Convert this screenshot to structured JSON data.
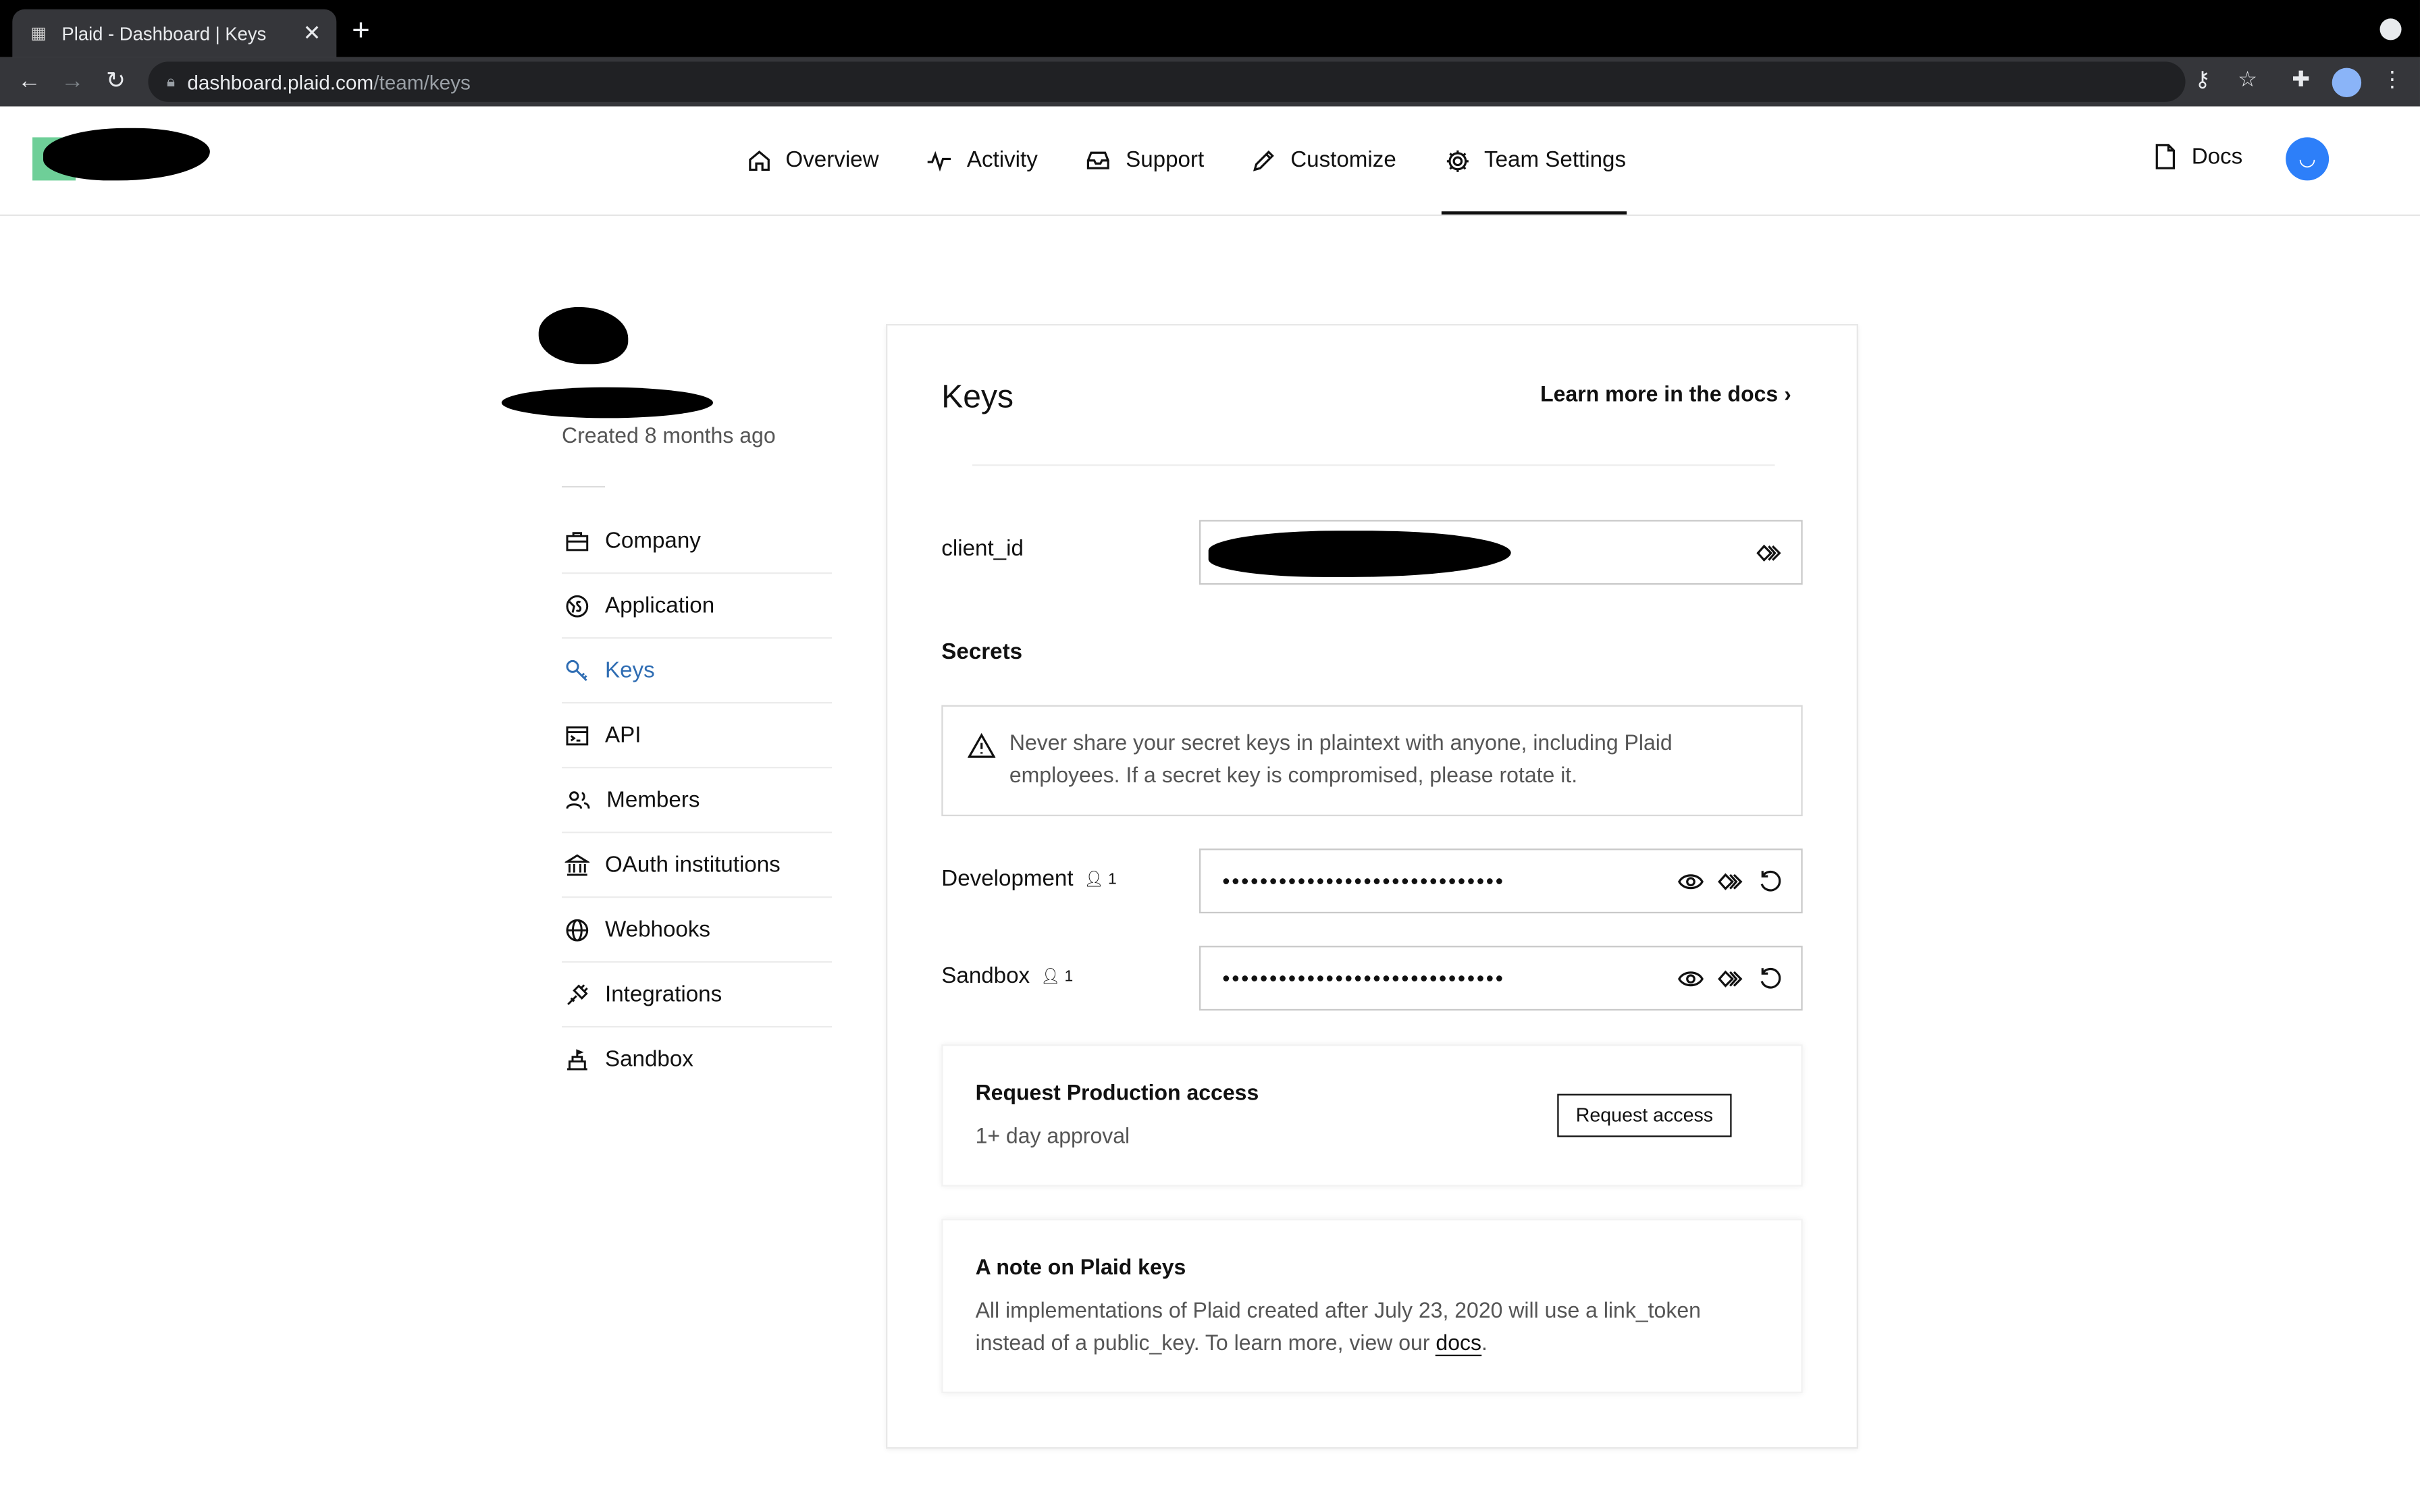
{
  "browser": {
    "tab_title": "Plaid - Dashboard | Keys",
    "url_host": "dashboard.plaid.com",
    "url_path": "/team/keys"
  },
  "header": {
    "nav": [
      {
        "label": "Overview",
        "icon": "home-icon"
      },
      {
        "label": "Activity",
        "icon": "activity-icon"
      },
      {
        "label": "Support",
        "icon": "inbox-icon"
      },
      {
        "label": "Customize",
        "icon": "pencil-icon"
      },
      {
        "label": "Team Settings",
        "icon": "gear-icon",
        "active": true
      }
    ],
    "docs_label": "Docs"
  },
  "sidebar": {
    "created": "Created 8 months ago",
    "items": [
      {
        "label": "Company",
        "icon": "briefcase-icon"
      },
      {
        "label": "Application",
        "icon": "globe-dollar-icon"
      },
      {
        "label": "Keys",
        "icon": "key-icon",
        "active": true
      },
      {
        "label": "API",
        "icon": "terminal-icon"
      },
      {
        "label": "Members",
        "icon": "people-icon"
      },
      {
        "label": "OAuth institutions",
        "icon": "bank-icon"
      },
      {
        "label": "Webhooks",
        "icon": "globe-icon"
      },
      {
        "label": "Integrations",
        "icon": "plug-icon"
      },
      {
        "label": "Sandbox",
        "icon": "sandcastle-icon"
      }
    ]
  },
  "keys": {
    "title": "Keys",
    "learn_more": "Learn more in the docs  ›",
    "client_id_label": "client_id",
    "secrets_heading": "Secrets",
    "warning": "Never share your secret keys in plaintext with anyone, including Plaid employees. If a secret key is compromised, please rotate it.",
    "secrets": [
      {
        "label": "Development",
        "seats": "1",
        "masked": "••••••••••••••••••••••••••••••"
      },
      {
        "label": "Sandbox",
        "seats": "1",
        "masked": "••••••••••••••••••••••••••••••"
      }
    ],
    "production": {
      "title": "Request Production access",
      "subtitle": "1+ day approval",
      "button": "Request access"
    },
    "note": {
      "title": "A note on Plaid keys",
      "body": "All implementations of Plaid created after July 23, 2020 will use a link_token instead of a public_key. To learn more, view our ",
      "link": "docs",
      "tail": "."
    }
  },
  "colors": {
    "accent": "#2f6db3",
    "avatar": "#2d7ff9",
    "logo_green": "#6ecf98"
  }
}
